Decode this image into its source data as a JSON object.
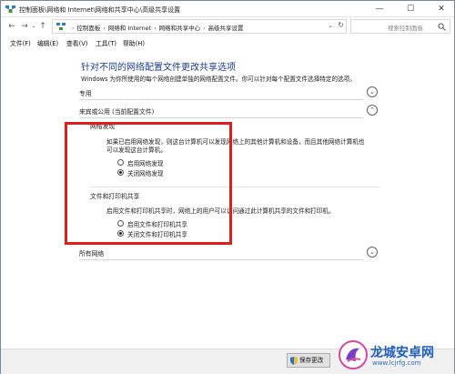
{
  "window": {
    "title": "控制面板\\网络和 Internet\\网络和共享中心\\高级共享设置",
    "controls": {
      "minimize": "—",
      "maximize": "☐",
      "close": "✕"
    }
  },
  "nav": {
    "back": "←",
    "forward": "→",
    "up": "↑"
  },
  "address": {
    "crumbs": [
      "控制面板",
      "网络和 Internet",
      "网络和共享中心",
      "高级共享设置"
    ],
    "dropdown": "⌄",
    "refresh": "↻"
  },
  "search": {
    "placeholder": "搜索控制面板"
  },
  "menu": {
    "items": [
      "文件(F)",
      "编辑(E)",
      "查看(V)",
      "工具(T)",
      "帮助(H)"
    ]
  },
  "page": {
    "title": "针对不同的网络配置文件更改共享选项",
    "intro": "Windows 为你所使用的每个网络创建单独的网络配置文件。你可以针对每个配置文件选择特定的选项。"
  },
  "sections": {
    "private": {
      "label": "专用",
      "chevron": "⌄"
    },
    "guest": {
      "label": "来宾或公用 (当前配置文件)",
      "chevron": "⌃"
    },
    "all": {
      "label": "所有网络",
      "chevron": "⌄"
    }
  },
  "discovery": {
    "title": "网络发现",
    "desc_line1": "如果已启用网络发现，则这台计算机可以发现网络上的其他计算机和设备，而且其他网络计算机也",
    "desc_line2": "可以发现这台计算机。",
    "options": [
      {
        "label": "启用网络发现",
        "checked": false
      },
      {
        "label": "关闭网络发现",
        "checked": true
      }
    ]
  },
  "filesharing": {
    "title": "文件和打印机共享",
    "desc": "启用文件和打印机共享时，网络上的用户可以访问通过此计算机共享的文件和打印机。",
    "options": [
      {
        "label": "启用文件和打印机共享",
        "checked": false
      },
      {
        "label": "关闭文件和打印机共享",
        "checked": true
      }
    ]
  },
  "footer": {
    "save_label": "保存更改"
  },
  "watermark": {
    "name": "龙城安卓网",
    "url": "www.lcjrfg.com"
  },
  "colors": {
    "title_blue": "#1e3c8c",
    "highlight_red": "#e21b1b"
  }
}
